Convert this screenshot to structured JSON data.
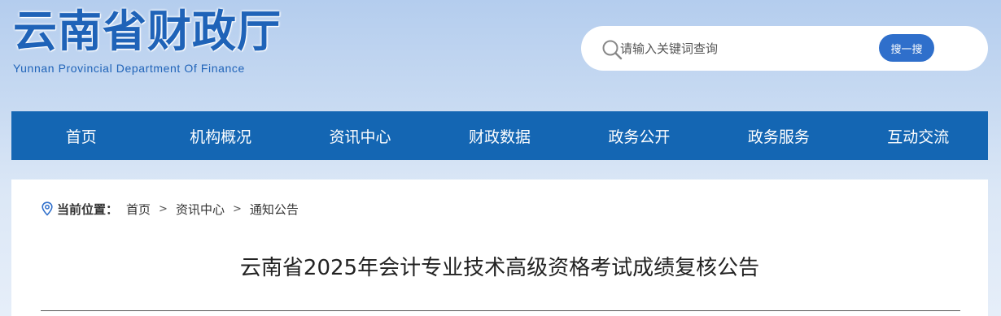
{
  "header": {
    "title_cn": "云南省财政厅",
    "title_en": "Yunnan Provincial Department Of Finance"
  },
  "search": {
    "placeholder": "请输入关键词查询",
    "button_label": "搜一搜",
    "icon": "search-icon"
  },
  "nav": {
    "items": [
      {
        "label": "首页"
      },
      {
        "label": "机构概况"
      },
      {
        "label": "资讯中心"
      },
      {
        "label": "财政数据"
      },
      {
        "label": "政务公开"
      },
      {
        "label": "政务服务"
      },
      {
        "label": "互动交流"
      }
    ]
  },
  "breadcrumb": {
    "label": "当前位置：",
    "icon": "location-pin-icon",
    "separator": ">",
    "items": [
      {
        "label": "首页"
      },
      {
        "label": "资讯中心"
      },
      {
        "label": "通知公告"
      }
    ]
  },
  "article": {
    "title": "云南省2025年会计专业技术高级资格考试成绩复核公告"
  },
  "colors": {
    "brand": "#1f63b8",
    "nav_bg": "#1466b3",
    "button": "#2f6fcb"
  }
}
